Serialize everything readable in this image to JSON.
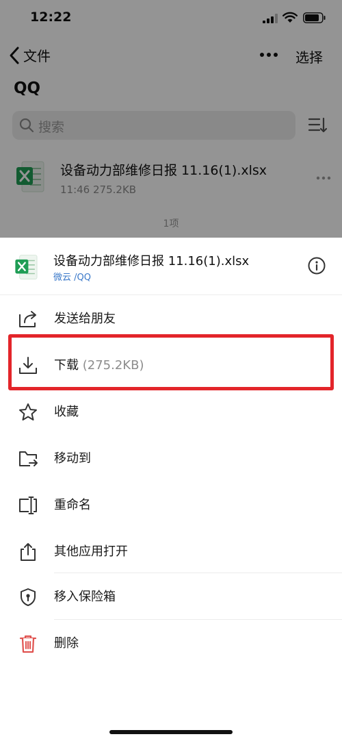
{
  "status_bar": {
    "time": "12:22"
  },
  "nav": {
    "back_label": "文件",
    "select_label": "选择"
  },
  "page_title": "QQ",
  "search": {
    "placeholder": "搜索"
  },
  "file_list": [
    {
      "name": "设备动力部维修日报 11.16(1).xlsx",
      "meta": "11:46 275.2KB",
      "icon": "excel-icon"
    }
  ],
  "item_count": "1项",
  "sheet": {
    "file_name": "设备动力部维修日报 11.16(1).xlsx",
    "file_path": "微云 /QQ",
    "actions": [
      {
        "label": "发送给朋友",
        "icon": "share-icon"
      },
      {
        "label": "下载",
        "sub": "(275.2KB)",
        "icon": "download-icon"
      },
      {
        "label": "收藏",
        "icon": "star-icon"
      },
      {
        "label": "移动到",
        "icon": "move-folder-icon"
      },
      {
        "label": "重命名",
        "icon": "rename-icon"
      },
      {
        "label": "其他应用打开",
        "icon": "open-with-icon"
      },
      {
        "label": "移入保险箱",
        "icon": "shield-icon"
      },
      {
        "label": "删除",
        "icon": "trash-icon"
      }
    ]
  },
  "colors": {
    "highlight": "#e3252a",
    "delete_icon": "#e0524f",
    "excel_green": "#1f9d55",
    "path_blue": "#3a78c9"
  }
}
